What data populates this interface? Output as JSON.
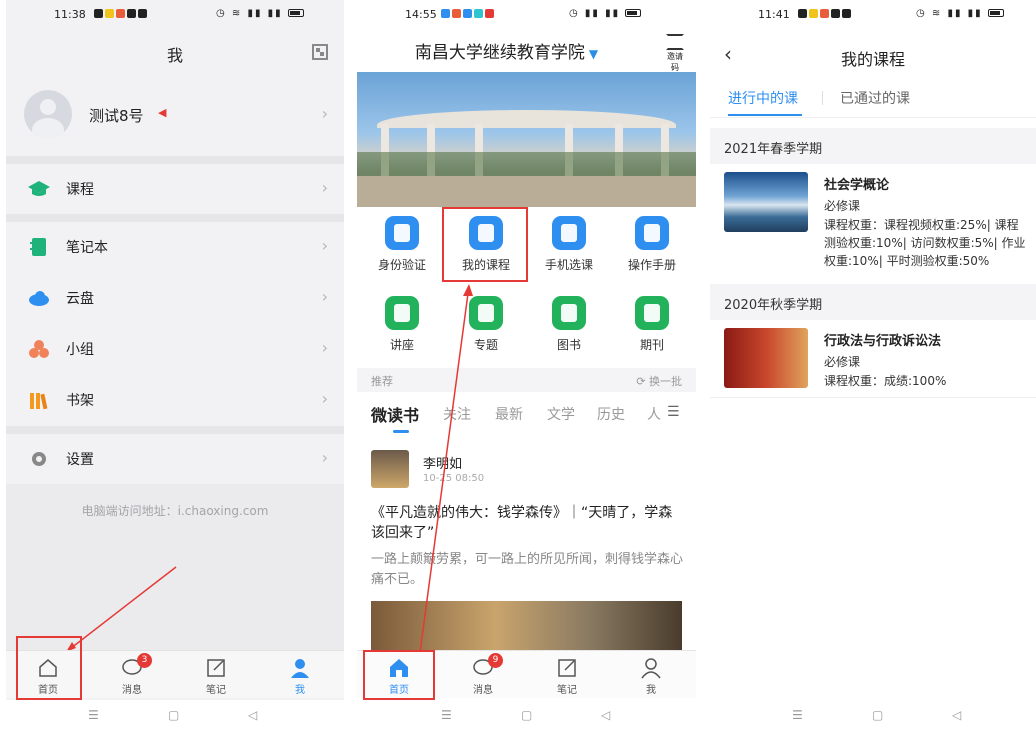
{
  "panel1": {
    "status_time": "11:38",
    "title": "我",
    "profile_name": "测试8号",
    "menu": [
      {
        "label": "课程",
        "icon": "graduation-cap-icon"
      },
      {
        "label": "笔记本",
        "icon": "notebook-icon"
      },
      {
        "label": "云盘",
        "icon": "cloud-icon"
      },
      {
        "label": "小组",
        "icon": "group-icon"
      },
      {
        "label": "书架",
        "icon": "bookshelf-icon"
      },
      {
        "label": "设置",
        "icon": "gear-icon"
      }
    ],
    "footer_url": "电脑端访问地址：i.chaoxing.com",
    "tabs": [
      "首页",
      "消息",
      "笔记",
      "我"
    ],
    "message_badge": "3"
  },
  "panel2": {
    "status_time": "14:55",
    "title": "南昌大学继续教育学院",
    "scan_label": "邀请码",
    "grid": [
      "身份验证",
      "我的课程",
      "手机选课",
      "操作手册",
      "讲座",
      "专题",
      "图书",
      "期刊"
    ],
    "rec_label": "推荐",
    "refresh_label": "换一批",
    "categories": [
      "微读书",
      "关注",
      "最新",
      "文学",
      "历史",
      "人"
    ],
    "post": {
      "author": "李明如",
      "time": "10-25 08:50",
      "title": "《平凡造就的伟大：钱学森传》｜“天晴了，学森该回来了”",
      "desc": "一路上颠簸劳累，可一路上的所见所闻，刺得钱学森心痛不已。"
    },
    "tabs": [
      "首页",
      "消息",
      "笔记",
      "我"
    ],
    "message_badge": "9"
  },
  "panel3": {
    "status_time": "11:41",
    "title": "我的课程",
    "tab_active": "进行中的课",
    "tab_other": "已通过的课",
    "terms": [
      {
        "term": "2021年春季学期",
        "course": "社会学概论",
        "type": "必修课",
        "weight": "课程权重：课程视频权重:25%| 课程测验权重:10%| 访问数权重:5%| 作业权重:10%| 平时测验权重:50%"
      },
      {
        "term": "2020年秋季学期",
        "course": "行政法与行政诉讼法",
        "type": "必修课",
        "weight": "课程权重：成绩:100%"
      }
    ]
  },
  "colors": {
    "accent": "#2e8ff0",
    "highlight": "#e53935",
    "green": "#23b25c"
  }
}
